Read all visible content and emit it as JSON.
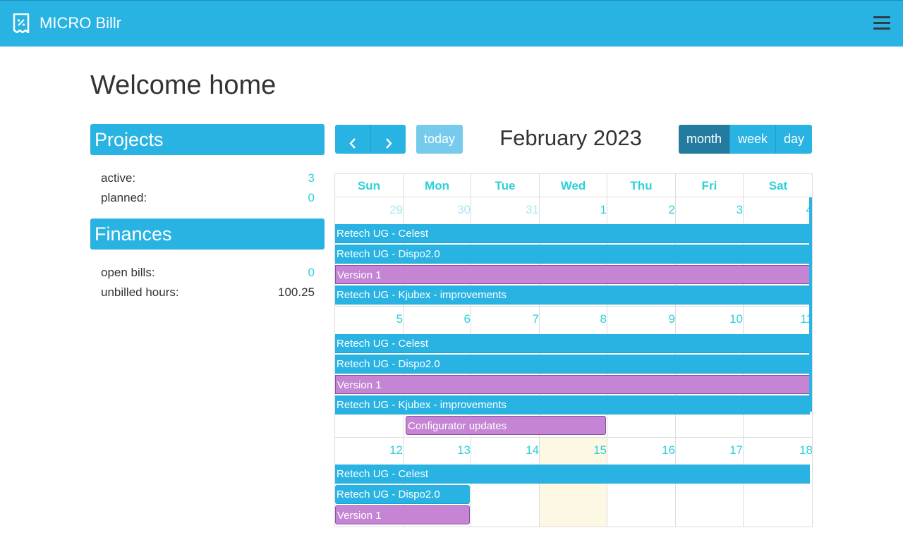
{
  "navbar": {
    "brand": "MICRO Billr"
  },
  "page": {
    "title": "Welcome home"
  },
  "projects": {
    "header": "Projects",
    "active_label": "active:",
    "active_value": "3",
    "planned_label": "planned:",
    "planned_value": "0"
  },
  "finances": {
    "header": "Finances",
    "open_bills_label": "open bills:",
    "open_bills_value": "0",
    "unbilled_label": "unbilled hours:",
    "unbilled_value": "100.25"
  },
  "calendar": {
    "title": "February 2023",
    "today_label": "today",
    "views": {
      "month": "month",
      "week": "week",
      "day": "day"
    },
    "active_view": "month",
    "weekdays": [
      "Sun",
      "Mon",
      "Tue",
      "Wed",
      "Thu",
      "Fri",
      "Sat"
    ],
    "weeks": [
      [
        "29",
        "30",
        "31",
        "1",
        "2",
        "3",
        "4"
      ],
      [
        "5",
        "6",
        "7",
        "8",
        "9",
        "10",
        "11"
      ],
      [
        "12",
        "13",
        "14",
        "15",
        "16",
        "17",
        "18"
      ]
    ],
    "today_day": "15",
    "events": {
      "w1": [
        "Retech UG - Celest",
        "Retech UG - Dispo2.0",
        "Version 1",
        "Retech UG - Kjubex - improvements"
      ],
      "w2": [
        "Retech UG - Celest",
        "Retech UG - Dispo2.0",
        "Version 1",
        "Retech UG - Kjubex - improvements",
        "Configurator updates"
      ],
      "w3": [
        "Retech UG - Celest",
        "Retech UG - Dispo2.0",
        "Version 1"
      ]
    },
    "colors": {
      "project": "#29b3e3",
      "version": "#c584d4",
      "today_bg": "#fcf8e3",
      "day_number": "#2ed0d8"
    }
  }
}
